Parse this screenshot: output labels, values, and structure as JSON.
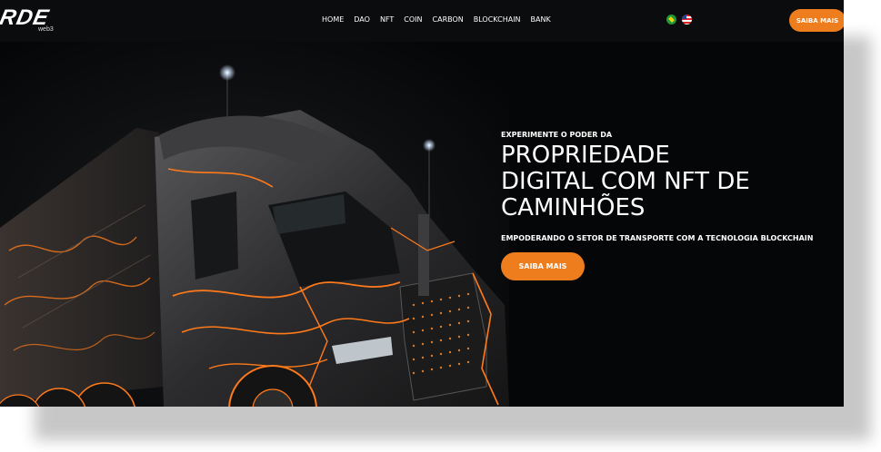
{
  "header": {
    "logo_text": "RDE",
    "logo_sub": "web3",
    "nav": [
      "HOME",
      "DAO",
      "NFT",
      "COIN",
      "CARBON",
      "BLOCKCHAIN",
      "BANK"
    ],
    "cta_label": "SAIBA MAIS"
  },
  "flags": [
    "brazil-flag-icon",
    "usa-flag-icon"
  ],
  "hero": {
    "eyebrow": "EXPERIMENTE O PODER DA",
    "headline_lines": [
      "PROPRIEDADE",
      "DIGITAL COM NFT DE",
      "CAMINHÕES"
    ],
    "subline": "EMPODERANDO O SETOR DE TRANSPORTE COM A TECNOLOGIA BLOCKCHAIN",
    "cta_label": "SAIBA MAIS",
    "image_icon": "truck-illustration"
  },
  "colors": {
    "accent": "#ee7d1d",
    "background": "#050607",
    "text": "#ffffff",
    "glow": "#ff7a1a"
  }
}
